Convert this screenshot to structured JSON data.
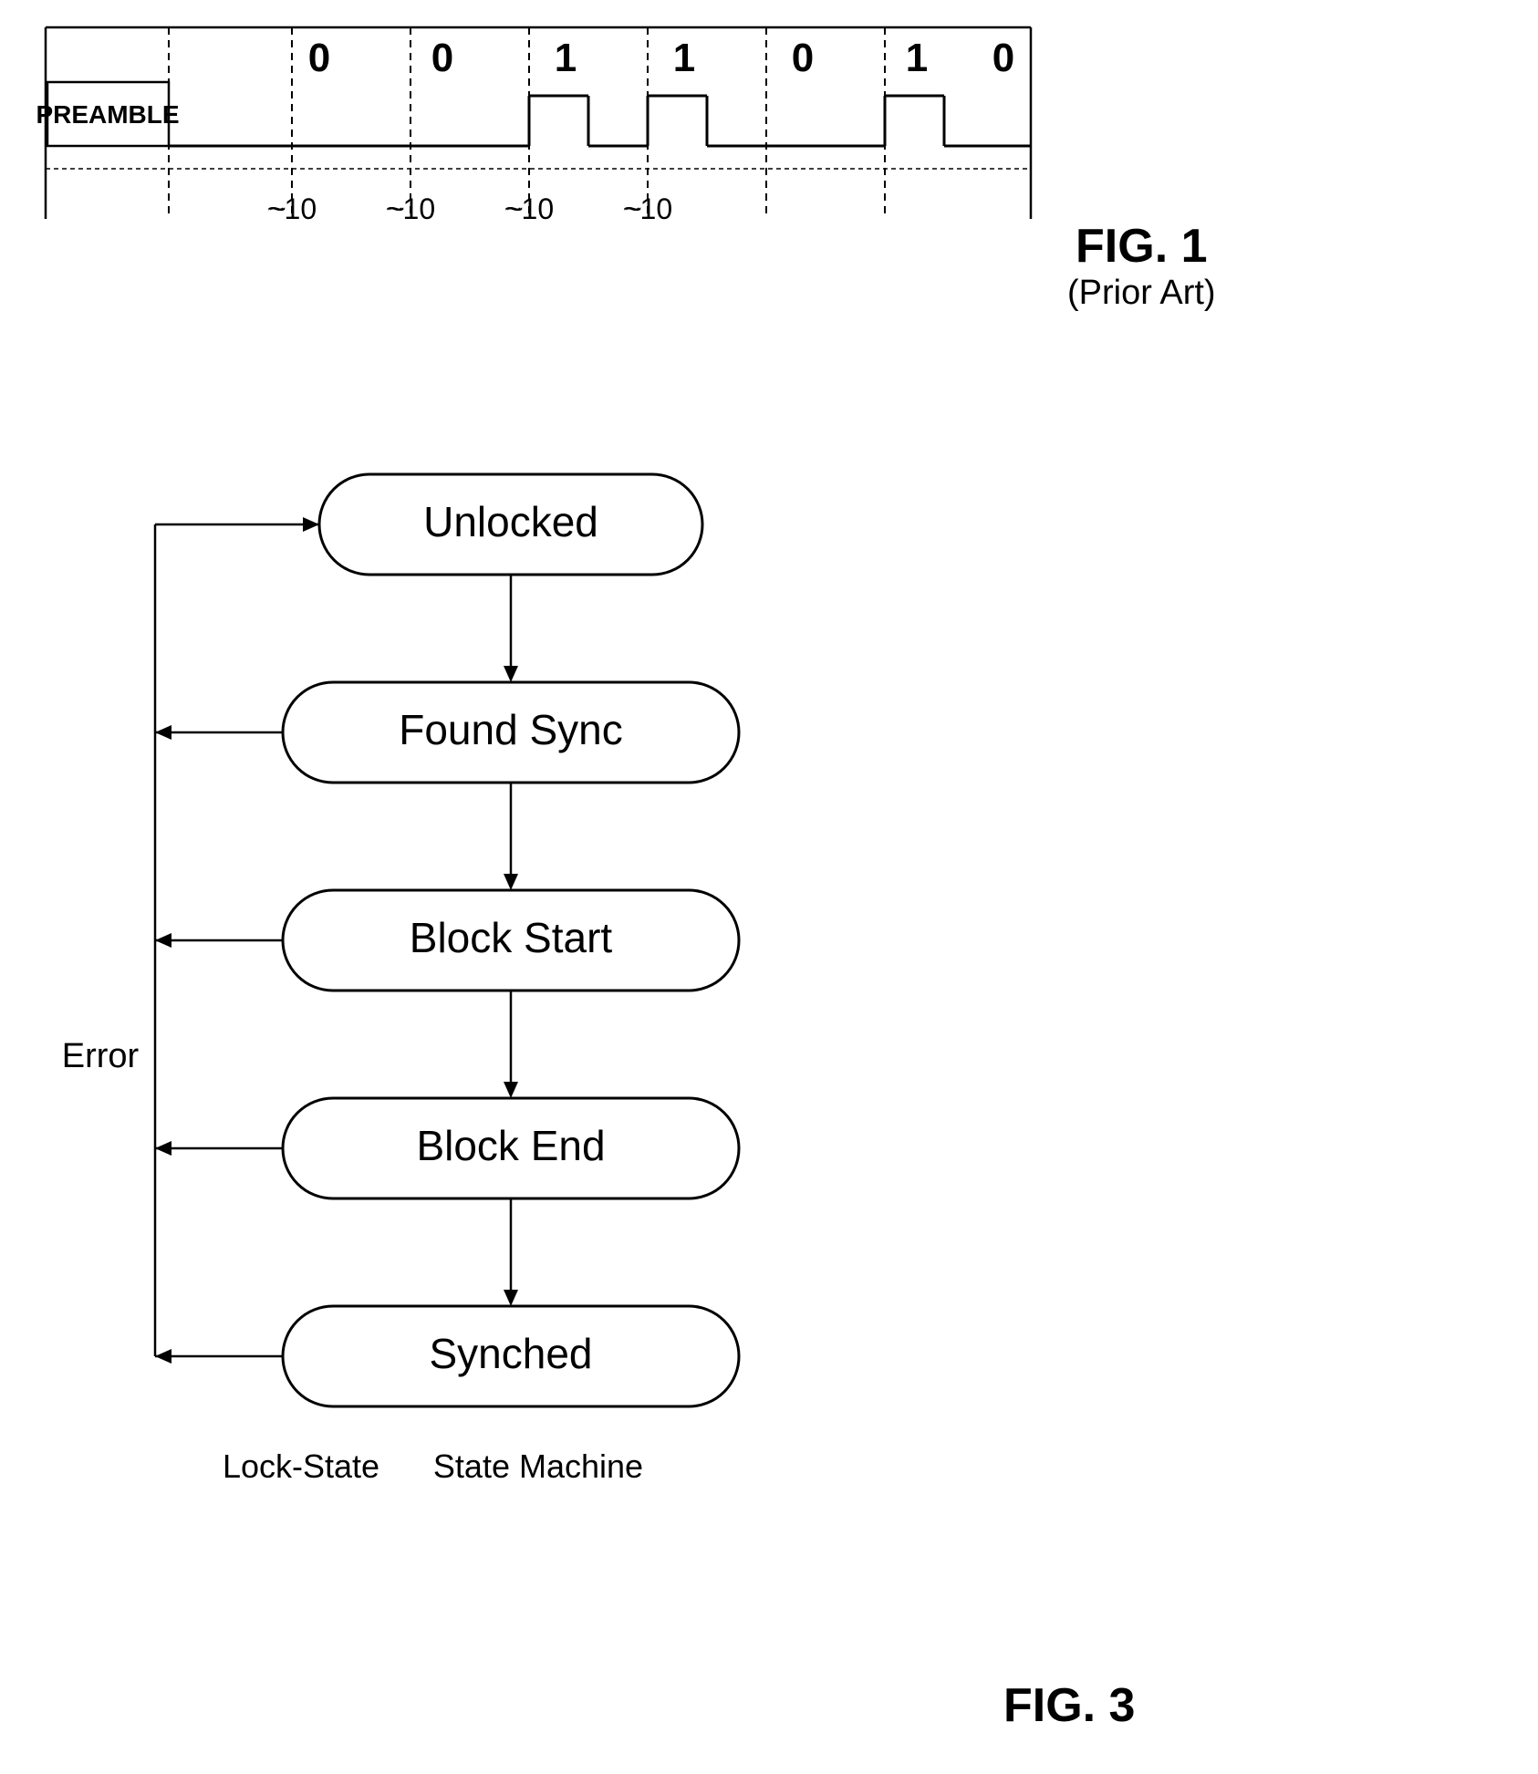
{
  "fig1": {
    "title": "FIG. 1",
    "subtitle": "(Prior Art)",
    "bits": [
      "0",
      "0",
      "1",
      "1",
      "0",
      "1",
      "0"
    ],
    "preamble": "PREAMBLE",
    "ticks": [
      "~10",
      "~10",
      "~10",
      "~10"
    ]
  },
  "fig3": {
    "title": "FIG. 3",
    "states": [
      {
        "id": "unlocked",
        "label": "Unlocked"
      },
      {
        "id": "found-sync",
        "label": "Found Sync"
      },
      {
        "id": "block-start",
        "label": "Block Start"
      },
      {
        "id": "block-end",
        "label": "Block End"
      },
      {
        "id": "synched",
        "label": "Synched"
      }
    ],
    "error_label": "Error",
    "bottom_label1": "Lock-State",
    "bottom_label2": "State Machine"
  }
}
